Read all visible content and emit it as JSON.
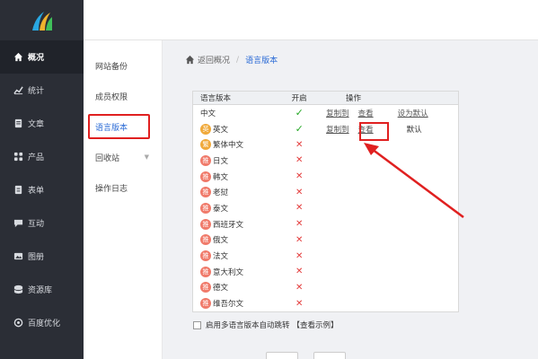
{
  "colors": {
    "sidebar_bg": "#2b2e36",
    "accent": "#2b6bd6",
    "highlight": "#e02020",
    "check": "#26a826",
    "cross": "#e33b3b"
  },
  "sidebar": {
    "items": [
      {
        "label": "概况",
        "icon": "home-icon",
        "active": true
      },
      {
        "label": "统计",
        "icon": "chart-icon"
      },
      {
        "label": "文章",
        "icon": "article-icon"
      },
      {
        "label": "产品",
        "icon": "product-icon"
      },
      {
        "label": "表单",
        "icon": "form-icon"
      },
      {
        "label": "互动",
        "icon": "chat-icon"
      },
      {
        "label": "图册",
        "icon": "album-icon"
      },
      {
        "label": "资源库",
        "icon": "database-icon"
      },
      {
        "label": "百度优化",
        "icon": "seo-icon"
      }
    ]
  },
  "subnav": {
    "items": [
      {
        "label": "网站备份"
      },
      {
        "label": "成员权限"
      },
      {
        "label": "语言版本",
        "active": true
      },
      {
        "label": "回收站",
        "chevron": "▼"
      },
      {
        "label": "操作日志"
      }
    ]
  },
  "breadcrumb": {
    "back": "返回概况",
    "sep": "/",
    "current": "语言版本"
  },
  "table": {
    "headers": {
      "name": "语言版本",
      "enabled": "开启",
      "ops": "操作"
    },
    "rows": [
      {
        "name": "中文",
        "enabled": true,
        "copy": "复制到",
        "view": "查看",
        "set_default": "设为默认"
      },
      {
        "name": "英文",
        "badge": "英",
        "gold": true,
        "enabled": true,
        "copy": "复制到",
        "view": "查看",
        "default": "默认"
      },
      {
        "name": "繁体中文",
        "badge": "繁",
        "gold": true,
        "enabled": false
      },
      {
        "name": "日文",
        "badge": "推",
        "enabled": false
      },
      {
        "name": "韩文",
        "badge": "推",
        "enabled": false
      },
      {
        "name": "老挝",
        "badge": "推",
        "enabled": false
      },
      {
        "name": "泰文",
        "badge": "推",
        "enabled": false
      },
      {
        "name": "西班牙文",
        "badge": "推",
        "enabled": false
      },
      {
        "name": "俄文",
        "badge": "推",
        "enabled": false
      },
      {
        "name": "法文",
        "badge": "推",
        "enabled": false
      },
      {
        "name": "意大利文",
        "badge": "推",
        "enabled": false
      },
      {
        "name": "德文",
        "badge": "推",
        "enabled": false
      },
      {
        "name": "维吾尔文",
        "badge": "推",
        "enabled": false
      }
    ],
    "check": "✓",
    "cross": "✕"
  },
  "auto_redirect": {
    "label": "启用多语言版本自动跳转",
    "example": "【查看示例】",
    "checked": false
  }
}
